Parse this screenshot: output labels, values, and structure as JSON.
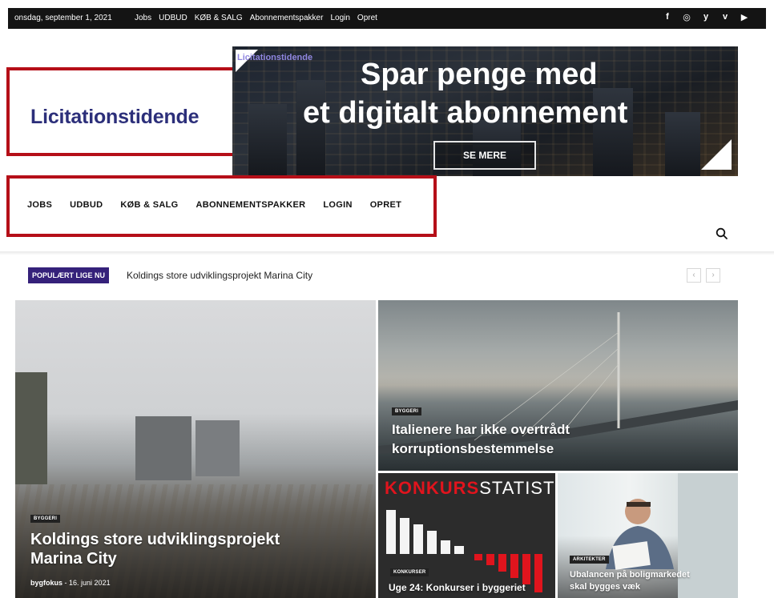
{
  "topbar": {
    "date": "onsdag, september 1, 2021",
    "links": [
      "Jobs",
      "UDBUD",
      "KØB & SALG",
      "Abonnementspakker",
      "Login",
      "Opret"
    ],
    "social": [
      "f",
      "◎",
      "y",
      "v",
      "▶"
    ],
    "social_icons": [
      "facebook-icon",
      "instagram-icon",
      "twitter-icon",
      "vimeo-icon",
      "youtube-icon"
    ]
  },
  "logo": {
    "text": "Licitationstidende"
  },
  "banner": {
    "logo": "Licitationstidende",
    "headline_line1": "Spar penge med",
    "headline_line2": "et digitalt abonnement",
    "button": "SE MERE"
  },
  "nav": {
    "items": [
      "JOBS",
      "UDBUD",
      "KØB & SALG",
      "ABONNEMENTSPAKKER",
      "LOGIN",
      "OPRET"
    ]
  },
  "popular": {
    "badge": "POPULÆRT LIGE NU",
    "headline": "Koldings store udviklingsprojekt Marina City",
    "prev": "‹",
    "next": "›"
  },
  "tiles": {
    "main": {
      "category": "BYGGERI",
      "title_line1": "Koldings store udviklingsprojekt",
      "title_line2": "Marina City",
      "author": "bygfokus",
      "date": "16. juni 2021"
    },
    "bridge": {
      "category": "BYGGERI",
      "title_line1": "Italienere har ikke overtrådt",
      "title_line2": "korruptionsbestemmelse"
    },
    "konkurs": {
      "graphic_red": "KONKURS",
      "graphic_white": "STATISTIK",
      "category": "KONKURSER",
      "title": "Uge 24: Konkurser i byggeriet"
    },
    "arkitekter": {
      "category": "ARKITEKTER",
      "title_line1": "Ubalancen på boligmarkedet",
      "title_line2": "skal bygges væk"
    }
  },
  "colors": {
    "accent_red": "#b50f18",
    "brand_blue": "#2c2f7a",
    "badge_purple": "#35217a"
  }
}
